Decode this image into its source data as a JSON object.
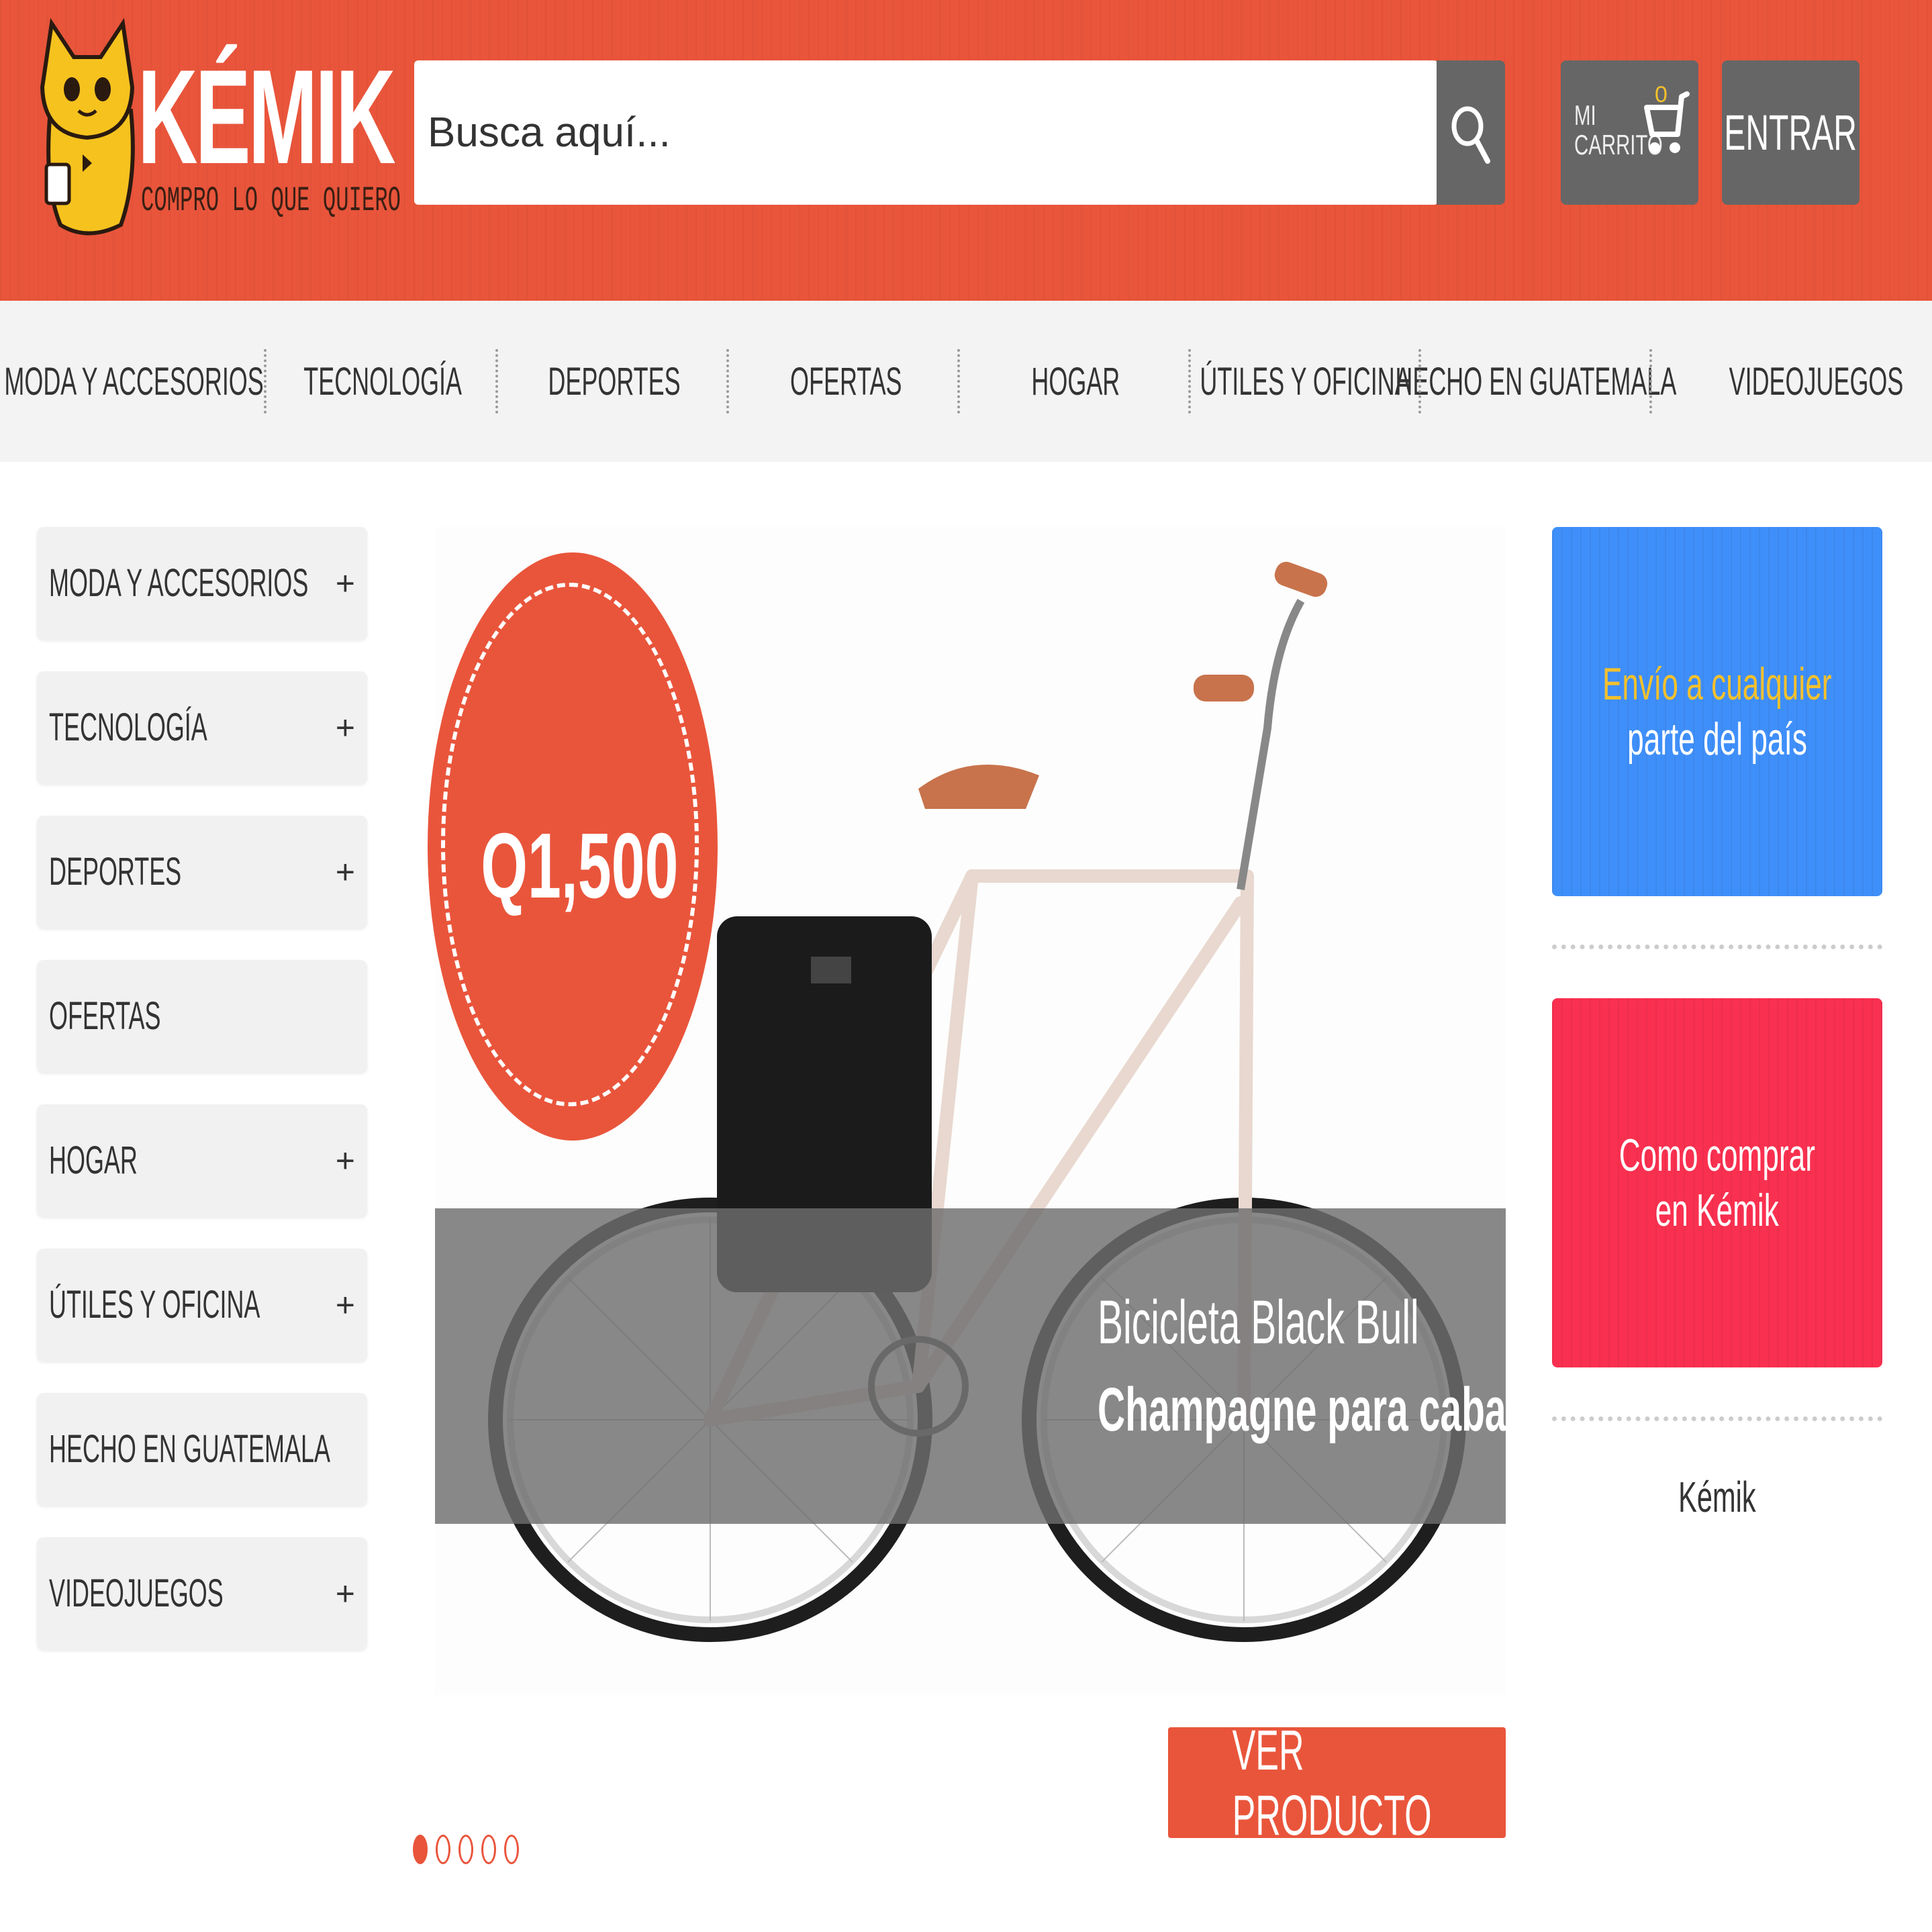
{
  "brand": {
    "name": "KÉMIK",
    "tagline": "COMPRO LO QUE QUIERO"
  },
  "search": {
    "placeholder": "Busca aquí..."
  },
  "cart": {
    "label_line1": "MI",
    "label_line2": "CARRITO",
    "count": "0"
  },
  "login": {
    "label": "ENTRAR"
  },
  "nav": {
    "items": [
      "MODA Y ACCESORIOS",
      "TECNOLOGÍA",
      "DEPORTES",
      "OFERTAS",
      "HOGAR",
      "ÚTILES Y OFICINA",
      "HECHO EN GUATEMALA",
      "VIDEOJUEGOS"
    ]
  },
  "sidebar": {
    "items": [
      {
        "label": "MODA Y ACCESORIOS",
        "toggle": "+"
      },
      {
        "label": "TECNOLOGÍA",
        "toggle": "+"
      },
      {
        "label": "DEPORTES",
        "toggle": "+"
      },
      {
        "label": "OFERTAS",
        "toggle": ""
      },
      {
        "label": "HOGAR",
        "toggle": "+"
      },
      {
        "label": "ÚTILES Y OFICINA",
        "toggle": "+"
      },
      {
        "label": "HECHO EN GUATEMALA",
        "toggle": ""
      },
      {
        "label": "VIDEOJUEGOS",
        "toggle": "+"
      }
    ]
  },
  "hero": {
    "price": "Q1,500",
    "title_line1": "Bicicleta Black Bull",
    "title_line2": "Champagne para caballero",
    "cta": "VER PRODUCTO",
    "slide_count": 5,
    "active_slide": 1
  },
  "promos": {
    "shipping_line1": "Envío a cualquier",
    "shipping_line2": "parte del país",
    "howto_line1": "Como comprar",
    "howto_line2": "en Kémik",
    "footer": "Kémik"
  },
  "colors": {
    "brand_orange": "#e9553b",
    "button_gray": "#666666",
    "promo_blue": "#3f8ffa",
    "promo_red": "#fa3050",
    "accent_yellow": "#f5c12c"
  }
}
